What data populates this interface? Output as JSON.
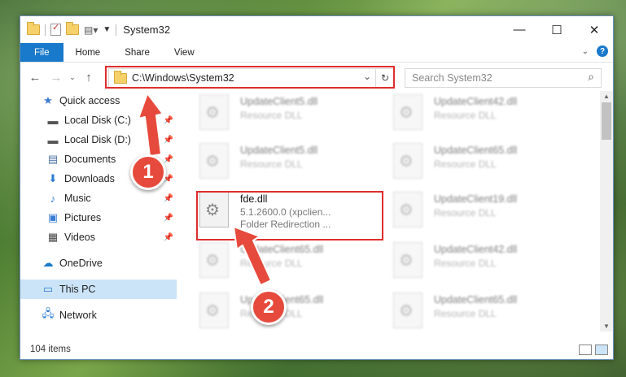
{
  "window": {
    "title": "System32"
  },
  "ribbon": {
    "tabs": [
      "File",
      "Home",
      "Share",
      "View"
    ]
  },
  "nav": {
    "address": "C:\\Windows\\System32",
    "search_placeholder": "Search System32"
  },
  "sidebar": {
    "items": [
      {
        "label": "Quick access",
        "icon": "star-icon",
        "pinned": false
      },
      {
        "label": "Local Disk (C:)",
        "icon": "drive-icon",
        "pinned": true
      },
      {
        "label": "Local Disk (D:)",
        "icon": "drive-icon",
        "pinned": true
      },
      {
        "label": "Documents",
        "icon": "documents-icon",
        "pinned": true
      },
      {
        "label": "Downloads",
        "icon": "download-icon",
        "pinned": true
      },
      {
        "label": "Music",
        "icon": "music-icon",
        "pinned": true
      },
      {
        "label": "Pictures",
        "icon": "pictures-icon",
        "pinned": true
      },
      {
        "label": "Videos",
        "icon": "videos-icon",
        "pinned": true
      },
      {
        "label": "OneDrive",
        "icon": "cloud-icon",
        "pinned": false
      },
      {
        "label": "This PC",
        "icon": "computer-icon",
        "pinned": false
      },
      {
        "label": "Network",
        "icon": "network-icon",
        "pinned": false
      }
    ]
  },
  "files": [
    {
      "name": "UpdateClient5.dll",
      "sub": "Resource DLL"
    },
    {
      "name": "UpdateClient42.dll",
      "sub": "Resource DLL"
    },
    {
      "name": "UpdateClient5.dll",
      "sub": "Resource DLL"
    },
    {
      "name": "UpdateClient65.dll",
      "sub": "Resource DLL"
    },
    {
      "name": "fde.dll",
      "sub": "5.1.2600.0 (xpclien...",
      "sub2": "Folder Redirection ..."
    },
    {
      "name": "UpdateClient19.dll",
      "sub": "Resource DLL"
    },
    {
      "name": "UpdateClient65.dll",
      "sub": "Resource DLL"
    },
    {
      "name": "UpdateClient42.dll",
      "sub": "Resource DLL"
    },
    {
      "name": "UpdateClient65.dll",
      "sub": "Resource DLL"
    },
    {
      "name": "UpdateClient65.dll",
      "sub": "Resource DLL"
    }
  ],
  "status": {
    "count": "104 items"
  },
  "callouts": {
    "one": "1",
    "two": "2"
  },
  "colors": {
    "accent": "#1979ca",
    "highlight": "#e02d2d",
    "badge": "#e64a3c"
  }
}
